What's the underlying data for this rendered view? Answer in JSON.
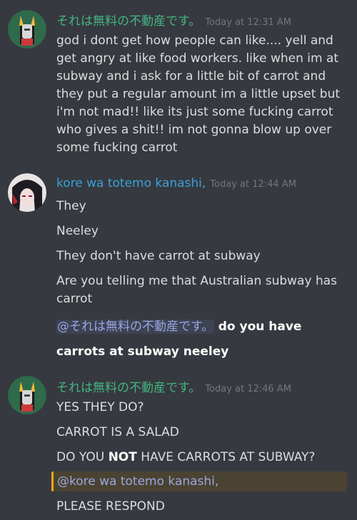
{
  "colors": {
    "background": "#36393f",
    "user1_name": "#43b581",
    "user2_name": "#3aa0db",
    "mention_highlight": "#faa61a"
  },
  "messages": [
    {
      "author": "それは無料の不動産です。",
      "timestamp": "Today at 12:31 AM",
      "avatar": "troll-avatar-icon",
      "lines": [
        "god i dont get how people can like.... yell and get angry at like food workers. like when im at subway and i ask for a little bit of carrot and they put a regular amount im a little upset but i'm not mad!! like its just some fucking carrot who gives a shit!! im not gonna blow up over some fucking carrot"
      ]
    },
    {
      "author": "kore wa totemo kanashi,",
      "timestamp": "Today at 12:44 AM",
      "avatar": "anime-avatar-icon",
      "lines": [
        "They",
        "Neeley",
        "They don't have carrot at subway",
        "Are you telling me that Australian subway has carrot"
      ],
      "mention": "@それは無料の不動産です。",
      "mention_text": "do you have carrots at subway neeley"
    },
    {
      "author": "それは無料の不動産です。",
      "timestamp": "Today at 12:46 AM",
      "avatar": "troll-avatar-icon",
      "lines": [
        "YES THEY DO?",
        "CARROT IS A SALAD"
      ],
      "line3_before": "DO YOU ",
      "line3_bold": "NOT",
      "line3_after": " HAVE CARROTS AT SUBWAY?",
      "mention": "@kore wa totemo kanashi,",
      "last_line": "PLEASE RESPOND"
    }
  ]
}
